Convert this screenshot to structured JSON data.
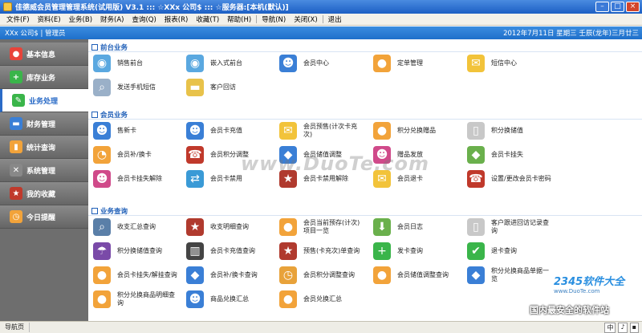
{
  "window": {
    "title": "佳德威会员管理管理系统(试用版) V3.1 ::: ☆XXx 公司$ ::: ☆服务器:[本机(默认)]",
    "min_label": "–",
    "max_label": "□",
    "close_label": "×"
  },
  "menu": [
    "文件(F)",
    "资料(E)",
    "业务(B)",
    "财务(A)",
    "查询(Q)",
    "报表(R)",
    "收藏(T)",
    "帮助(H)",
    "导航(N)",
    "关闭(X)",
    "退出"
  ],
  "header": {
    "company": "XXx 公司$ | 管理员",
    "date": "2012年7月11日  星期三  壬辰(龙年)三月廿三"
  },
  "sidebar": [
    {
      "label": "基本信息",
      "icon": "base-info-icon",
      "color": "#e8443a",
      "glyph": "●"
    },
    {
      "label": "库存业务",
      "icon": "plus-icon",
      "color": "#3ab54a",
      "glyph": "+"
    },
    {
      "label": "业务处理",
      "icon": "pen-icon",
      "color": "#3ab54a",
      "glyph": "✎"
    },
    {
      "label": "财务管理",
      "icon": "money-icon",
      "color": "#3a7fd6",
      "glyph": "▬"
    },
    {
      "label": "统计查询",
      "icon": "chart-icon",
      "color": "#f2a33a",
      "glyph": "▮"
    },
    {
      "label": "系统管理",
      "icon": "tools-icon",
      "color": "#888888",
      "glyph": "✕"
    },
    {
      "label": "我的收藏",
      "icon": "star-icon",
      "color": "#c0392b",
      "glyph": "★"
    },
    {
      "label": "今日提醒",
      "icon": "clock-icon",
      "color": "#f2a33a",
      "glyph": "◷"
    }
  ],
  "sections": [
    {
      "title": "前台业务",
      "rows": [
        [
          {
            "label": "销售前台",
            "icon": "sale-badge-icon",
            "color": "#5aa8e0",
            "glyph": "◉"
          },
          {
            "label": "嵌入式前台",
            "icon": "sale-badge-icon",
            "color": "#5aa8e0",
            "glyph": "◉"
          },
          {
            "label": "会员中心",
            "icon": "users-icon",
            "color": "#3a7fd6",
            "glyph": "☻"
          },
          {
            "label": "定单管理",
            "icon": "bulb-icon",
            "color": "#f2a33a",
            "glyph": "●"
          },
          {
            "label": "短信中心",
            "icon": "envelope-icon",
            "color": "#f2c33a",
            "glyph": "✉"
          }
        ],
        [
          {
            "label": "发送手机短信",
            "icon": "search-doc-icon",
            "color": "#9ab0c8",
            "glyph": "⌕"
          },
          {
            "label": "客户回访",
            "icon": "folder-icon",
            "color": "#e8c24a",
            "glyph": "▬"
          }
        ]
      ]
    },
    {
      "title": "会员业务",
      "rows": [
        [
          {
            "label": "售新卡",
            "icon": "users-icon",
            "color": "#3a7fd6",
            "glyph": "☻"
          },
          {
            "label": "会员卡充值",
            "icon": "users-icon",
            "color": "#3a7fd6",
            "glyph": "☻"
          },
          {
            "label": "会员预售(计次卡充次)",
            "icon": "envelope-icon",
            "color": "#f2c33a",
            "glyph": "✉"
          },
          {
            "label": "积分兑换赠品",
            "icon": "speech-bubble-icon",
            "color": "#f2a33a",
            "glyph": "●"
          },
          {
            "label": "积分换储值",
            "icon": "document-icon",
            "color": "#c8c8c8",
            "glyph": "▯"
          }
        ],
        [
          {
            "label": "会员补/换卡",
            "icon": "pie-chart-icon",
            "color": "#f2a33a",
            "glyph": "◔"
          },
          {
            "label": "会员积分调整",
            "icon": "phone-icon",
            "color": "#c0392b",
            "glyph": "☎"
          },
          {
            "label": "会员储值调整",
            "icon": "tag-icon",
            "color": "#3a7fd6",
            "glyph": "◆"
          },
          {
            "label": "赠品发放",
            "icon": "people-icon",
            "color": "#d04a8a",
            "glyph": "☻"
          },
          {
            "label": "会员卡挂失",
            "icon": "tag-icon",
            "color": "#6ab04c",
            "glyph": "◆"
          }
        ],
        [
          {
            "label": "会员卡挂失解除",
            "icon": "people-icon",
            "color": "#d04a8a",
            "glyph": "☻"
          },
          {
            "label": "会员卡禁用",
            "icon": "refresh-icon",
            "color": "#3a9ad6",
            "glyph": "⇄"
          },
          {
            "label": "会员卡禁用解除",
            "icon": "star-icon",
            "color": "#b03a2e",
            "glyph": "★"
          },
          {
            "label": "会员退卡",
            "icon": "envelope-icon",
            "color": "#f2c33a",
            "glyph": "✉"
          },
          {
            "label": "设置/更改会员卡密码",
            "icon": "phone-icon",
            "color": "#c0392b",
            "glyph": "☎"
          }
        ]
      ]
    },
    {
      "title": "业务查询",
      "rows": [
        [
          {
            "label": "收支汇总查询",
            "icon": "magnifier-icon",
            "color": "#5a7fa8",
            "glyph": "⌕"
          },
          {
            "label": "收支明细查询",
            "icon": "star-icon",
            "color": "#b03a2e",
            "glyph": "★"
          },
          {
            "label": "会员当前预存(计次)项目一览",
            "icon": "speech-bubble-icon",
            "color": "#f2a33a",
            "glyph": "●"
          },
          {
            "label": "会员日志",
            "icon": "download-doc-icon",
            "color": "#6ab04c",
            "glyph": "⬇"
          },
          {
            "label": "客户跟进回访记录查询",
            "icon": "document-icon",
            "color": "#c8c8c8",
            "glyph": "▯"
          }
        ],
        [
          {
            "label": "积分换储值查询",
            "icon": "umbrella-icon",
            "color": "#7a4aa8",
            "glyph": "☂"
          },
          {
            "label": "会员卡充值查询",
            "icon": "barcode-icon",
            "color": "#444444",
            "glyph": "▥"
          },
          {
            "label": "预售(卡充次)单查询",
            "icon": "star-icon",
            "color": "#b03a2e",
            "glyph": "★"
          },
          {
            "label": "发卡查询",
            "icon": "add-doc-icon",
            "color": "#3ab54a",
            "glyph": "+"
          },
          {
            "label": "退卡查询",
            "icon": "checkmark-icon",
            "color": "#3ab54a",
            "glyph": "✔"
          }
        ],
        [
          {
            "label": "会员卡挂失/解挂查询",
            "icon": "speech-bubble-icon",
            "color": "#f2a33a",
            "glyph": "●"
          },
          {
            "label": "会员补/换卡查询",
            "icon": "tag-icon",
            "color": "#3a7fd6",
            "glyph": "◆"
          },
          {
            "label": "会员积分调整查询",
            "icon": "clock-icon",
            "color": "#e8a23a",
            "glyph": "◷"
          },
          {
            "label": "会员储值调整查询",
            "icon": "bulb-icon",
            "color": "#f2a33a",
            "glyph": "●"
          },
          {
            "label": "积分兑换商品单据一览",
            "icon": "tag-icon",
            "color": "#3a7fd6",
            "glyph": "◆"
          }
        ],
        [
          {
            "label": "积分兑换商品明细查询",
            "icon": "speech-bubble-icon",
            "color": "#f2a33a",
            "glyph": "●"
          },
          {
            "label": "商品兑换汇总",
            "icon": "users-icon",
            "color": "#3a7fd6",
            "glyph": "☻"
          },
          {
            "label": "会员兑换汇总",
            "icon": "speech-bubble-icon",
            "color": "#f2a33a",
            "glyph": "●"
          }
        ]
      ]
    }
  ],
  "statusbar": {
    "nav_page": "导航页",
    "ime": [
      "中",
      "♪",
      "▪"
    ]
  },
  "watermarks": {
    "duote": "www.DuoTe.com",
    "brand": "2345软件大全",
    "brand_url": "www.DuoTe.com",
    "slogan": "国内最安全的软件站"
  }
}
